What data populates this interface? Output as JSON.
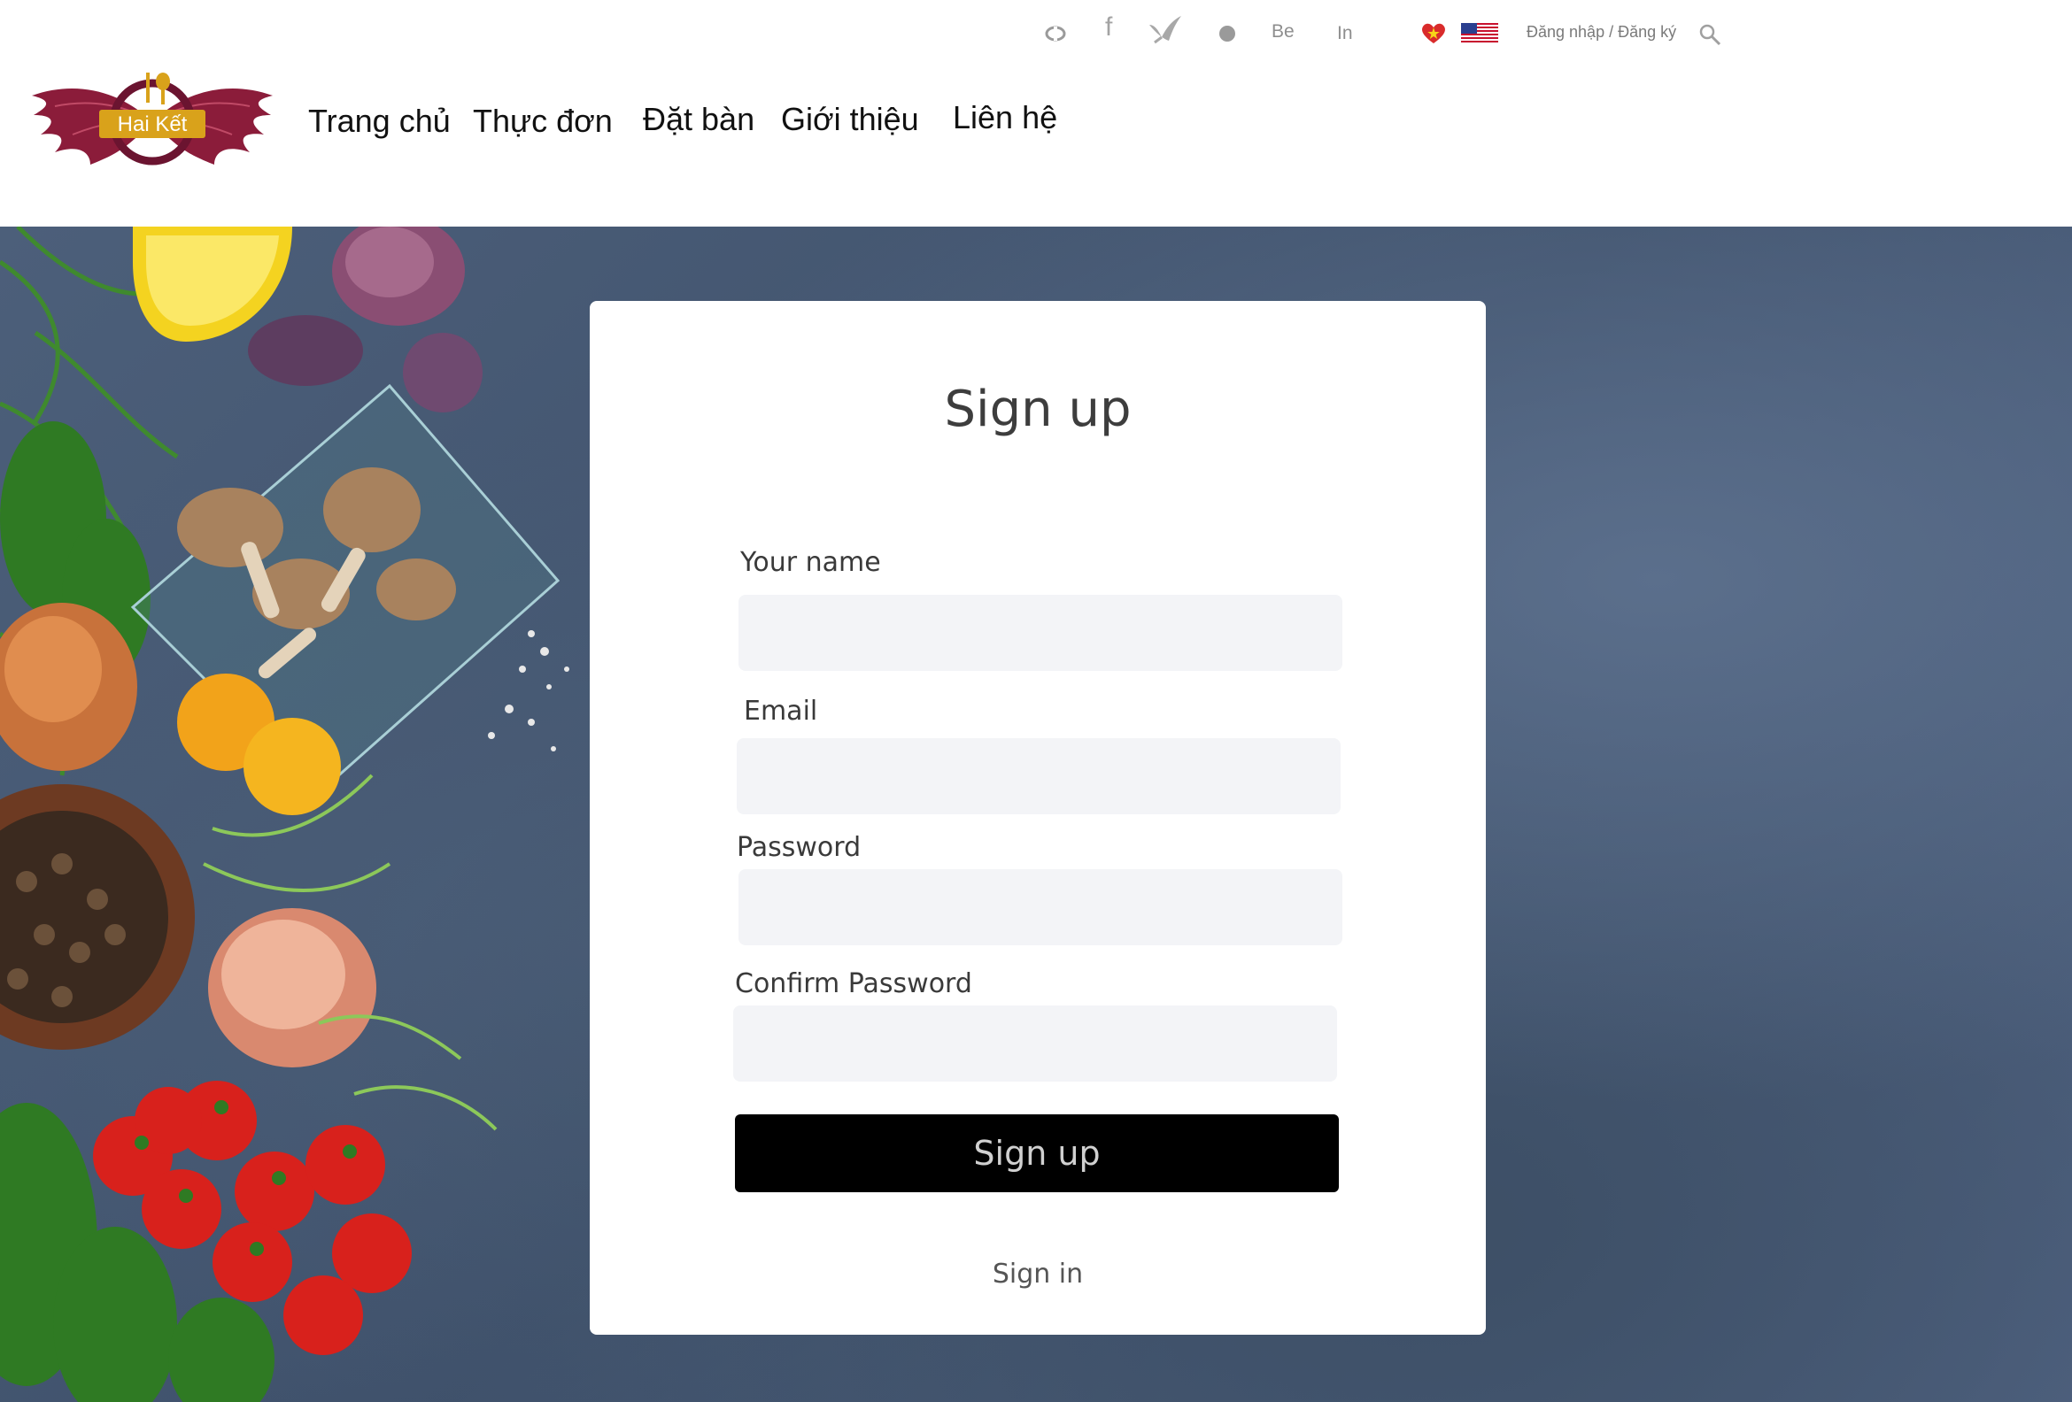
{
  "header": {
    "social": {
      "dribbble_icon": "dribbble-icon",
      "facebook_label": "f",
      "twitter_icon": "bird-icon",
      "dot_icon": "circle-icon",
      "behance_label": "Be",
      "linkedin_label": "In",
      "vn_flag_icon": "vietnam-flag-icon",
      "us_flag_icon": "us-flag-icon",
      "auth_label": "Đăng nhập / Đăng ký",
      "search_icon": "search-icon"
    },
    "logo": {
      "text": "Hai Kết",
      "brand_color": "#8b1c3a",
      "accent_color": "#d9a21b"
    },
    "nav": [
      {
        "label": "Trang chủ"
      },
      {
        "label": "Thực đơn"
      },
      {
        "label": "Đặt bàn"
      },
      {
        "label": "Giới thiệu"
      },
      {
        "label": "Liên hệ"
      }
    ]
  },
  "form": {
    "title": "Sign up",
    "fields": [
      {
        "label": "Your name",
        "value": "",
        "placeholder": ""
      },
      {
        "label": "Email",
        "value": "",
        "placeholder": ""
      },
      {
        "label": "Password",
        "value": "",
        "placeholder": ""
      },
      {
        "label": "Confirm Password",
        "value": "",
        "placeholder": ""
      }
    ],
    "submit_label": "Sign up",
    "signin_label": "Sign in"
  }
}
